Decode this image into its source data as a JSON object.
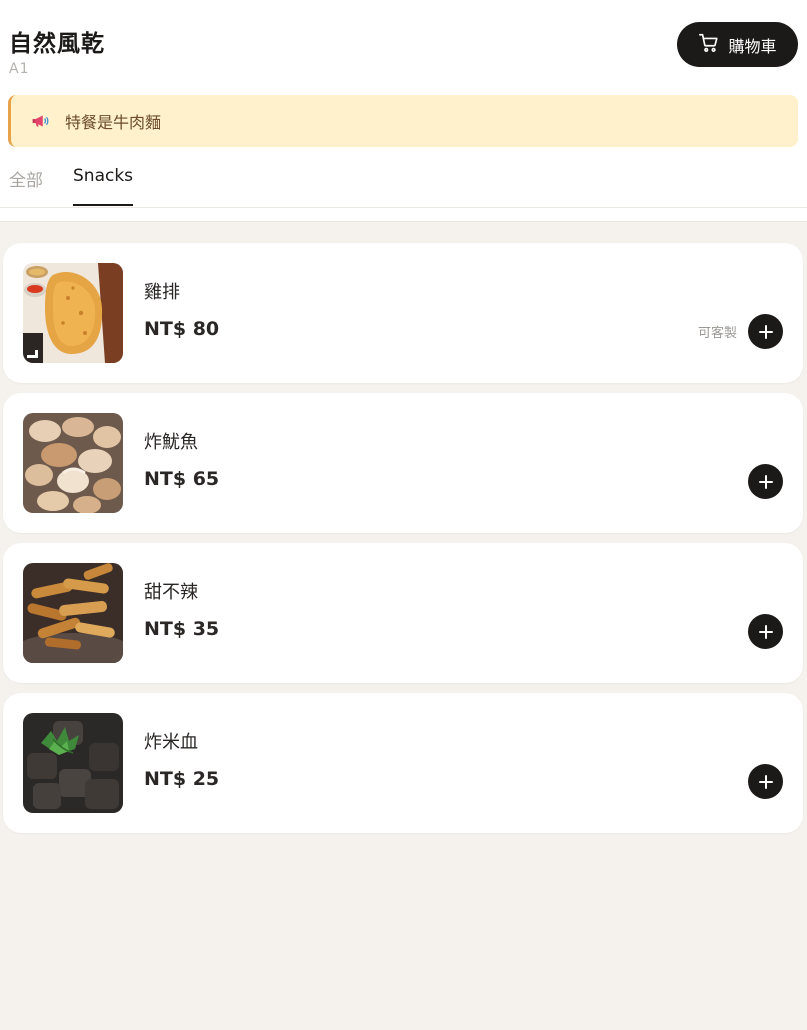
{
  "header": {
    "store_name": "自然風乾",
    "table_no": "A1",
    "cart_label": "購物車"
  },
  "notice": {
    "icon": "megaphone-icon",
    "text": "特餐是牛肉麵"
  },
  "tabs": [
    {
      "label": "全部",
      "active": false
    },
    {
      "label": "Snacks",
      "active": true
    }
  ],
  "items": [
    {
      "name": "雞排",
      "price": "NT$ 80",
      "custom_label": "可客製",
      "customizable": true,
      "image": "fried-chicken-cutlet"
    },
    {
      "name": "炸魷魚",
      "price": "NT$ 65",
      "custom_label": "",
      "customizable": false,
      "image": "fried-squid"
    },
    {
      "name": "甜不辣",
      "price": "NT$ 35",
      "custom_label": "",
      "customizable": false,
      "image": "tempura-fishcake"
    },
    {
      "name": "炸米血",
      "price": "NT$ 25",
      "custom_label": "",
      "customizable": false,
      "image": "fried-rice-blood-cake"
    }
  ],
  "colors": {
    "background": "#f5f2ee",
    "dark": "#1c1a19",
    "notice_bg": "#fff1cc",
    "notice_border": "#e7a24a"
  }
}
